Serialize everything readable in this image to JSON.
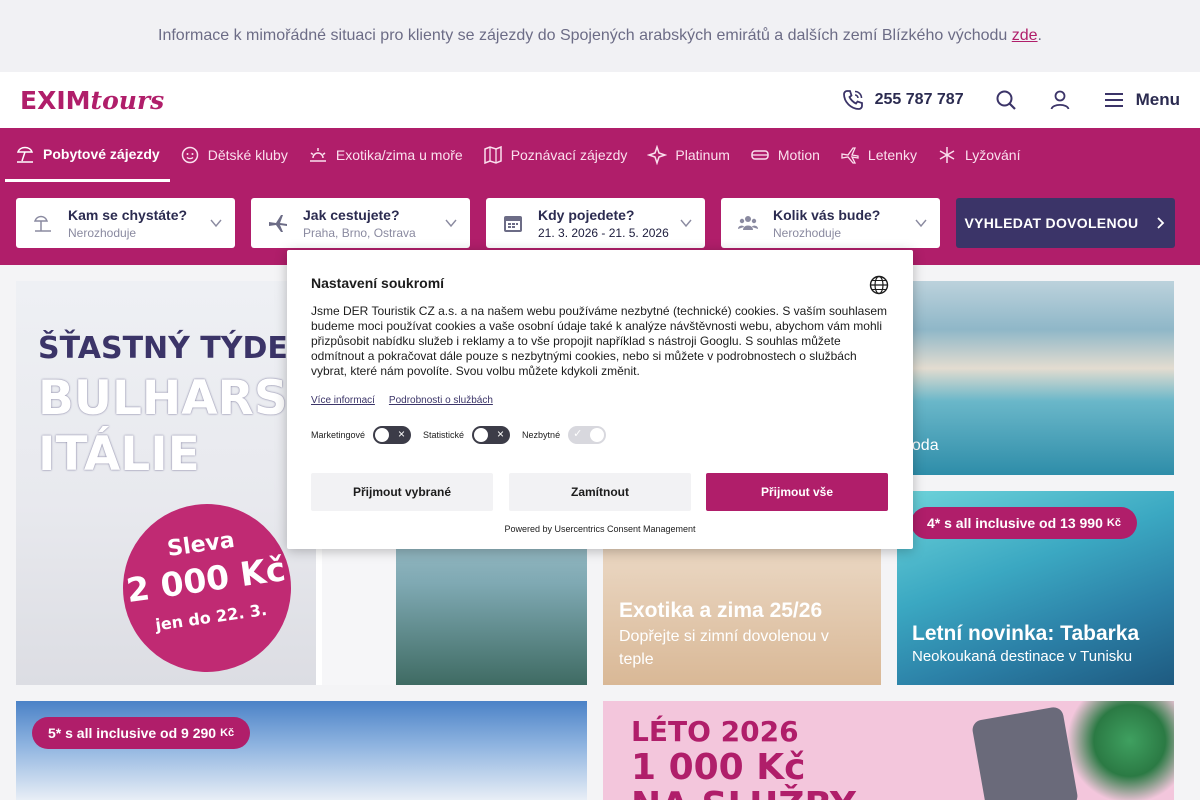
{
  "info_bar": {
    "text": "Informace k mimořádné situaci pro klienty se zájezdy do Spojených arabských emirátů a dalších zemí Blízkého východu",
    "link": "zde",
    "tail": "."
  },
  "header": {
    "logo_exim": "EXIM",
    "logo_tours": "tours",
    "phone": "255 787 787",
    "menu_label": "Menu"
  },
  "nav": {
    "items": [
      {
        "label": "Pobytové zájezdy",
        "icon": "beach-umbrella-icon"
      },
      {
        "label": "Dětské kluby",
        "icon": "kids-club-icon"
      },
      {
        "label": "Exotika/zima u moře",
        "icon": "sun-icon"
      },
      {
        "label": "Poznávací zájezdy",
        "icon": "map-icon"
      },
      {
        "label": "Platinum",
        "icon": "sparkle-icon"
      },
      {
        "label": "Motion",
        "icon": "motion-icon"
      },
      {
        "label": "Letenky",
        "icon": "plane-icon"
      },
      {
        "label": "Lyžování",
        "icon": "snowflake-icon"
      }
    ]
  },
  "search": {
    "destination": {
      "label": "Kam se chystáte?",
      "value": "Nerozhoduje"
    },
    "transport": {
      "label": "Jak cestujete?",
      "value": "Praha, Brno, Ostrava"
    },
    "date": {
      "label": "Kdy pojedete?",
      "value": "21. 3. 2026 - 21. 5. 2026"
    },
    "people": {
      "label": "Kolik vás bude?",
      "value": "Nerozhoduje"
    },
    "button": "VYHLEDAT DOVOLENOU"
  },
  "tiles": {
    "bulgaria": {
      "line1": "ŠŤASTNÝ TÝDEN",
      "line2": "BULHARSK",
      "line3": "ITÁLIE",
      "sale1": "Sleva",
      "sale2": "2 000 Kč",
      "sale3": "jen do 22. 3."
    },
    "beach_partial": "hoda",
    "woman": {
      "title": "Exotika a zima 25/26",
      "subtitle": "Dopřejte si zimní dovolenou v teple"
    },
    "tabarka": {
      "pill": "4* s all inclusive od 13 990",
      "pill_unit": "Kč",
      "title": "Letní novinka: Tabarka",
      "subtitle": "Neokoukaná destinace v Tunisku"
    },
    "sea2": {
      "pill": "5* s all inclusive od 9 290",
      "pill_unit": "Kč"
    },
    "leto": {
      "line1": "LÉTO 2026",
      "line2": "1 000 Kč",
      "line3": "NA SLUŽBY"
    }
  },
  "consent": {
    "title": "Nastavení soukromí",
    "body": "Jsme DER Touristik CZ a.s. a na našem webu používáme nezbytné (technické) cookies. S vaším souhlasem budeme moci používat cookies a vaše osobní údaje také k analýze návštěvnosti webu, abychom vám mohli přizpůsobit nabídku služeb i reklamy a to vše propojit například s nástroji Googlu. S souhlas můžete odmítnout a pokračovat dále pouze s nezbytnými cookies, nebo si můžete v podrobnostech o službách vybrat, které nám povolíte. Svou volbu můžete kdykoli změnit.",
    "link_more": "Více informací",
    "link_details": "Podrobnosti o službách",
    "toggle_marketing": "Marketingové",
    "toggle_stats": "Statistické",
    "toggle_necessary": "Nezbytné",
    "btn_accept_selected": "Přijmout vybrané",
    "btn_reject": "Zamítnout",
    "btn_accept_all": "Přijmout vše",
    "powered_by": "Powered by Usercentrics Consent Management"
  },
  "colors": {
    "brand": "#b01e6a",
    "dark": "#3b3468"
  }
}
